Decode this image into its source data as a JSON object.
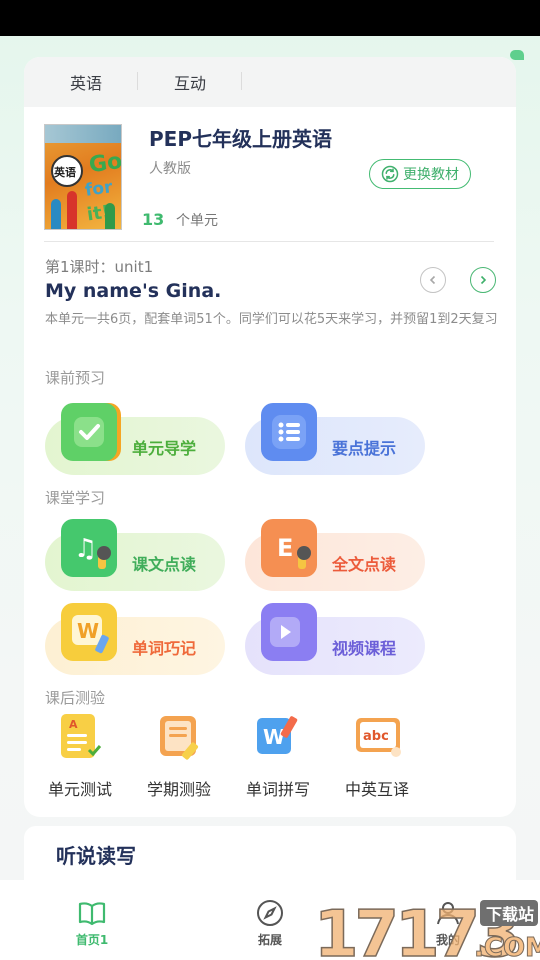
{
  "tabs": [
    {
      "label": "英语"
    },
    {
      "label": "互动"
    }
  ],
  "book": {
    "title": "PEP七年级上册英语",
    "publisher": "人教版",
    "change_label": "更换教材",
    "unit_count": "13",
    "unit_suffix": "个单元",
    "cover": {
      "subject": "英语",
      "go": "Go",
      "for": "for",
      "it": "it!"
    }
  },
  "lesson": {
    "number": "第1课时：unit1",
    "title": "My name's Gina.",
    "description": "本单元一共6页，配套单词51个。同学们可以花5天来学习，并预留1到2天复习"
  },
  "sections": {
    "preview": "课前预习",
    "classroom": "课堂学习",
    "after": "课后测验"
  },
  "features": {
    "unit_guide": "单元导学",
    "key_points": "要点提示",
    "text_reading": "课文点读",
    "full_reading": "全文点读",
    "word_memory": "单词巧记",
    "video_course": "视频课程"
  },
  "tests": [
    {
      "label": "单元测试"
    },
    {
      "label": "学期测验"
    },
    {
      "label": "单词拼写"
    },
    {
      "label": "中英互译"
    }
  ],
  "lower": {
    "title": "听说读写"
  },
  "bottom_nav": [
    {
      "label": "首页1"
    },
    {
      "label": "拓展"
    },
    {
      "label": "我的"
    }
  ],
  "watermark": {
    "digits": "17173",
    "badge": "下载站",
    "com": ".COM"
  },
  "colors": {
    "accent_green": "#3fba6f",
    "title_navy": "#23315a"
  }
}
